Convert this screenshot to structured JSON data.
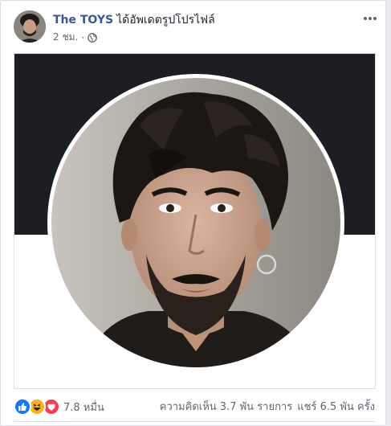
{
  "post": {
    "author": "The TOYS",
    "action": "ได้อัพเดตรูปโปรไฟล์",
    "time": "2 ชม.",
    "separator": "·",
    "privacy_icon": "globe-icon",
    "menu_icon": "more-options-icon"
  },
  "photo": {
    "background_top_color": "#1c1e21",
    "background_bottom_color": "#ffffff",
    "ring_color": "#ffffff"
  },
  "footer": {
    "reactions": [
      {
        "icon": "like-reaction-icon",
        "color": "#1877f2"
      },
      {
        "icon": "haha-reaction-icon",
        "color": "#f7b125"
      },
      {
        "icon": "love-reaction-icon",
        "color": "#f33e58"
      }
    ],
    "reaction_count": "7.8 หมื่น",
    "comments": "ความคิดเห็น 3.7 พัน รายการ",
    "shares": "แชร์ 6.5 พัน ครั้ง"
  },
  "colors": {
    "author_link": "#385898",
    "meta_text": "#616770",
    "card_border": "#dddfe2"
  }
}
